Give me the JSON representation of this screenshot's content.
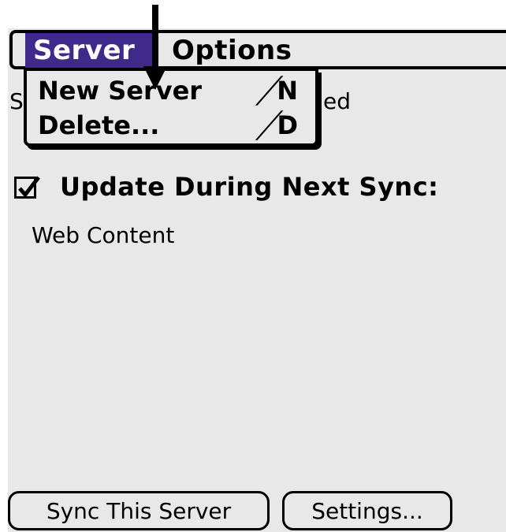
{
  "menubar": {
    "menus": [
      "Server",
      "Options"
    ],
    "active_menu": "Server"
  },
  "dropdown": {
    "items": [
      {
        "label": "New Server",
        "shortcut": "N"
      },
      {
        "label": "Delete...",
        "shortcut": "D"
      }
    ]
  },
  "main": {
    "partial_left": "S",
    "partial_right": "ed",
    "update_checkbox": {
      "label": "Update During Next Sync:",
      "checked": true
    },
    "content_items": [
      "Web Content"
    ]
  },
  "buttons": {
    "sync": "Sync This Server",
    "settings": "Settings..."
  },
  "colors": {
    "screen_bg": "#e8e8e8",
    "menu_highlight": "#3f2a8c",
    "text": "#000000"
  },
  "icons": {
    "annotation": "arrow-down-icon",
    "checkbox": "checkmark-icon",
    "shortcut": "command-stroke-icon"
  }
}
